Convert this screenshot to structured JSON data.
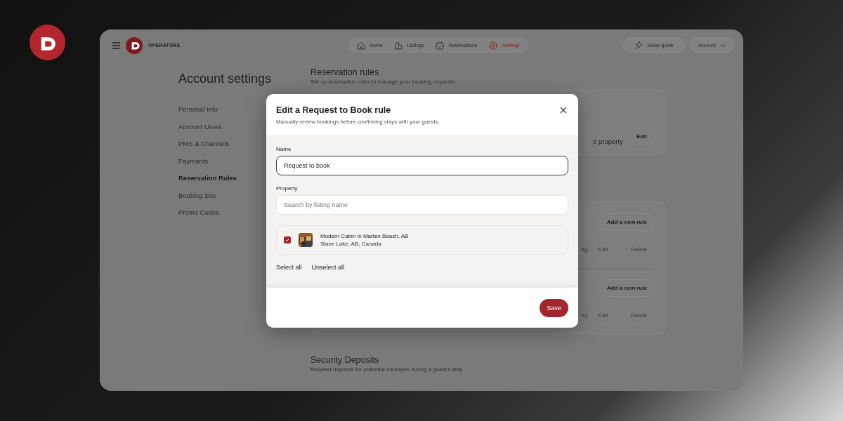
{
  "brand": {
    "name": "OPERATORS"
  },
  "nav": [
    {
      "label": "Home",
      "selected": false
    },
    {
      "label": "Listings",
      "selected": false
    },
    {
      "label": "Reservations",
      "selected": false
    },
    {
      "label": "Settings",
      "selected": true
    }
  ],
  "setup_guide": "Setup guide",
  "account": "Account",
  "sidebar": {
    "title": "Account settings",
    "items": [
      {
        "label": "Personal Info",
        "selected": false
      },
      {
        "label": "Account Users",
        "selected": false
      },
      {
        "label": "PMS & Channels",
        "selected": false
      },
      {
        "label": "Payments",
        "selected": false
      },
      {
        "label": "Reservation Rules",
        "selected": true
      },
      {
        "label": "Booking Site",
        "selected": false
      },
      {
        "label": "Promo Codes",
        "selected": false
      }
    ]
  },
  "section": {
    "title": "Reservation rules",
    "subtitle": "Set up reservation rules to manage your booking requests."
  },
  "rule_card": {
    "count": "0 property",
    "button": "Edit"
  },
  "rule_groups": [
    {
      "add_button": "Add a new rule",
      "partial_text": "ng",
      "edit": "Edit",
      "delete": "Delete"
    },
    {
      "add_button": "Add a new rule",
      "partial_text": "ng",
      "edit": "Edit",
      "delete": "Delete"
    }
  ],
  "security": {
    "title": "Security Deposits",
    "subtitle": "Request deposits for potential damages during a guest's stay"
  },
  "modal": {
    "title": "Edit a Request to Book rule",
    "subtitle": "Manually review bookings before confirming stays with your guests",
    "name_label": "Name",
    "name_value": "Request to book",
    "property_label": "Property",
    "search_placeholder": "Search by listing name",
    "properties": [
      {
        "title": "Modern Cabin in Marten Beach, AB",
        "location": "Slave Lake, AB, Canada",
        "checked": true
      }
    ],
    "select_all": "Select all",
    "unselect_all": "Unselect all",
    "save": "Save"
  }
}
